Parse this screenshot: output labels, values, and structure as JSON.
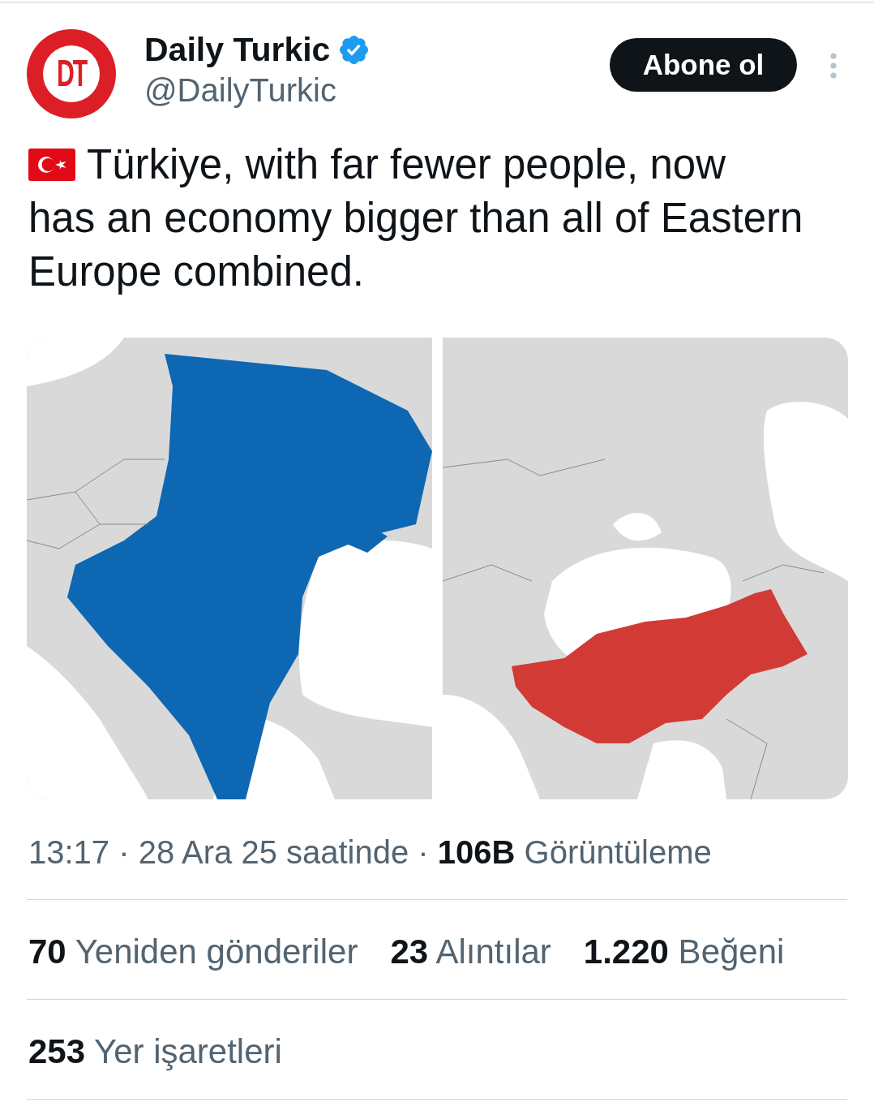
{
  "post": {
    "avatar": {
      "initials": "DT"
    },
    "author": {
      "name": "Daily Turkic",
      "verified": true,
      "handle": "@DailyTurkic"
    },
    "follow_button": "Abone ol",
    "text_lines": [
      "Türkiye, with far fewer people, now",
      "has an economy bigger than all of Eastern",
      "Europe combined."
    ],
    "media": [
      {
        "kind": "europe",
        "color": "#0d67b3"
      },
      {
        "kind": "turkey",
        "color": "#d13a35"
      }
    ],
    "meta": "13:17 · 28 Ara 25 saatinde · **106B** Görüntüleme",
    "stats": [
      {
        "count": "70",
        "label": "Yeniden gönderiler"
      },
      {
        "count": "23",
        "label": "Alıntılar"
      },
      {
        "count": "1.220",
        "label": "Beğeni"
      }
    ],
    "bookmarks": {
      "count": "253",
      "label": "Yer işaretleri"
    }
  }
}
